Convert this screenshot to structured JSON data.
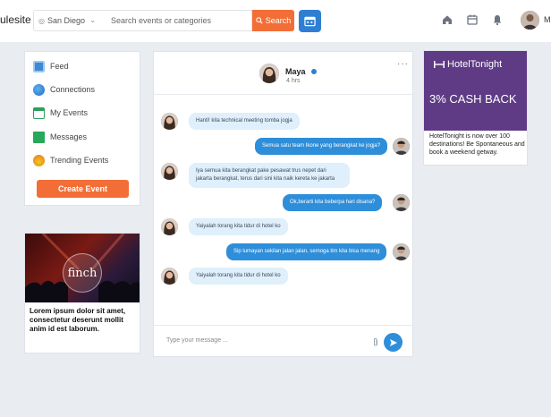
{
  "header": {
    "brand": "ulesite",
    "location": "San Diego",
    "search_placeholder": "Search events or categories",
    "search_button": "Search",
    "user_initial": "M"
  },
  "menu": {
    "items": [
      {
        "label": "Feed",
        "icon": "feed-icon"
      },
      {
        "label": "Connections",
        "icon": "globe-icon"
      },
      {
        "label": "My Events",
        "icon": "calendar-icon"
      },
      {
        "label": "Messages",
        "icon": "mail-icon"
      },
      {
        "label": "Trending Events",
        "icon": "trending-icon"
      }
    ],
    "create_button": "Create Event"
  },
  "promo": {
    "logo_text": "finch",
    "text": "Lorem ipsum dolor sit amet, consectetur deserunt mollit anim id est laborum."
  },
  "chat": {
    "contact_name": "Maya",
    "contact_status": "4 hrs",
    "messages": [
      {
        "from": "her",
        "text": "Hanti! kita technical meeting tomba jogja"
      },
      {
        "from": "me",
        "text": "Semua satu team Ikone yang berangkat ke jogja?"
      },
      {
        "from": "her",
        "text": "Iya semua kita berangkat pake pesawat trus nepet dari jakarta berangkat, terus dari sini kita naik kereta ke jakarta"
      },
      {
        "from": "me",
        "text": "Ok,berarti kita beberpa hari disana?"
      },
      {
        "from": "her",
        "text": "Yaiyalah torang kita tidur di hotel ko"
      },
      {
        "from": "me",
        "text": "Sip lumayan sekilan jalan jalan, semoga tim kita bisa menang"
      },
      {
        "from": "her",
        "text": "Yaiyalah torang kita tidur di hotel ko"
      }
    ],
    "compose_placeholder": "Type your message ..."
  },
  "ad": {
    "brand": "HotelTonight",
    "headline": "3% CASH BACK",
    "text": "HotelTonight is now over 100 destinations! Be Spontaneous and book a weekend getway."
  },
  "colors": {
    "accent_orange": "#f36e37",
    "accent_blue": "#2e8ed9",
    "ad_purple": "#5f3b86"
  }
}
